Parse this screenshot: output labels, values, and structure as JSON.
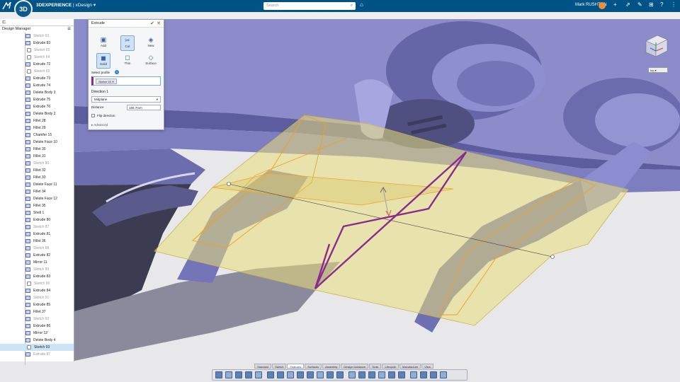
{
  "app": {
    "brand_title": "3DEXPERIENCE",
    "separator": "|",
    "app_name": "xDesign",
    "compass_label": "3D"
  },
  "search": {
    "placeholder": "Search"
  },
  "user": {
    "name": "Mark RUSHTON"
  },
  "tree": {
    "title": "Design Manager",
    "items": [
      {
        "label": "Sketch 63",
        "kind": "sketch",
        "dim": true
      },
      {
        "label": "Extrude 83",
        "kind": "feature"
      },
      {
        "label": "Sketch 65",
        "kind": "sketch",
        "dim": true,
        "sub": true
      },
      {
        "label": "Sketch 64",
        "kind": "sketch",
        "dim": true,
        "sub": true
      },
      {
        "label": "Extrude 72",
        "kind": "feature"
      },
      {
        "label": "Sketch 69",
        "kind": "sketch",
        "dim": true,
        "sub": true
      },
      {
        "label": "Extrude 73",
        "kind": "feature"
      },
      {
        "label": "Extrude 74",
        "kind": "feature"
      },
      {
        "label": "Delete Body 3",
        "kind": "feature"
      },
      {
        "label": "Extrude 75",
        "kind": "feature"
      },
      {
        "label": "Extrude 76",
        "kind": "feature"
      },
      {
        "label": "Delete Body 2",
        "kind": "feature"
      },
      {
        "label": "Fillet 28",
        "kind": "feature"
      },
      {
        "label": "Fillet 29",
        "kind": "feature"
      },
      {
        "label": "Chamfer 15",
        "kind": "feature"
      },
      {
        "label": "Delete Face 10",
        "kind": "feature"
      },
      {
        "label": "Fillet 30",
        "kind": "feature"
      },
      {
        "label": "Fillet 31",
        "kind": "feature"
      },
      {
        "label": "Sketch 80",
        "kind": "sketch",
        "dim": true
      },
      {
        "label": "Fillet 32",
        "kind": "feature"
      },
      {
        "label": "Fillet 33",
        "kind": "feature"
      },
      {
        "label": "Delete Face 11",
        "kind": "feature"
      },
      {
        "label": "Fillet 34",
        "kind": "feature"
      },
      {
        "label": "Delete Face 12",
        "kind": "feature"
      },
      {
        "label": "Fillet 35",
        "kind": "feature"
      },
      {
        "label": "Shell 1",
        "kind": "feature"
      },
      {
        "label": "Extrude 80",
        "kind": "feature"
      },
      {
        "label": "Sketch 87",
        "kind": "sketch",
        "dim": true
      },
      {
        "label": "Extrude 81",
        "kind": "feature"
      },
      {
        "label": "Fillet 36",
        "kind": "feature"
      },
      {
        "label": "Sketch 88",
        "kind": "sketch",
        "dim": true
      },
      {
        "label": "Extrude 82",
        "kind": "feature"
      },
      {
        "label": "Mirror 11",
        "kind": "feature"
      },
      {
        "label": "Sketch 89",
        "kind": "sketch",
        "dim": true
      },
      {
        "label": "Extrude 83",
        "kind": "feature"
      },
      {
        "label": "Sketch 90",
        "kind": "sketch",
        "dim": true,
        "sub": true
      },
      {
        "label": "Extrude 84",
        "kind": "feature"
      },
      {
        "label": "Sketch 91",
        "kind": "sketch",
        "dim": true
      },
      {
        "label": "Extrude 85",
        "kind": "feature"
      },
      {
        "label": "Fillet 37",
        "kind": "feature"
      },
      {
        "label": "Sketch 92",
        "kind": "sketch",
        "dim": true
      },
      {
        "label": "Extrude 86",
        "kind": "feature"
      },
      {
        "label": "Mirror 12",
        "kind": "feature"
      },
      {
        "label": "Delete Body 4",
        "kind": "feature"
      },
      {
        "label": "Sketch 93",
        "kind": "sketch",
        "sub": true,
        "selected": true
      },
      {
        "label": "Extrude 87",
        "kind": "feature",
        "dim": true
      }
    ]
  },
  "dialog": {
    "title": "Extrude",
    "operations": [
      {
        "label": "Add",
        "glyph": "▣",
        "icon": "add-icon"
      },
      {
        "label": "Cut",
        "glyph": "✂",
        "icon": "cut-icon",
        "active": true
      },
      {
        "label": "New",
        "glyph": "◈",
        "icon": "new-body-icon"
      },
      {
        "label": "Solid",
        "glyph": "◼",
        "icon": "solid-icon",
        "active": true
      },
      {
        "label": "Thin",
        "glyph": "◻",
        "icon": "thin-icon"
      },
      {
        "label": "Surface",
        "glyph": "◇",
        "icon": "surface-icon"
      }
    ],
    "profile_label": "Select profile",
    "profile_count": "1",
    "profile_chip": "Sketch 93",
    "direction_label": "Direction 1",
    "direction_value": "Midplane",
    "distance_label": "Distance",
    "distance_value": "165.7mm",
    "flip_label": "Flip direction",
    "advanced_label": "Advanced"
  },
  "zoom": {
    "value": "Iso"
  },
  "ribbon_tabs": [
    "Standard",
    "Sketch",
    "Features",
    "Surfaces",
    "Assembly",
    "Design Guidance",
    "Tools",
    "Lifecycle",
    "Manufacture",
    "View"
  ],
  "active_tab": "Features",
  "colors": {
    "topbar": "#005386",
    "model_blue": "#7e7fc3",
    "preview_fill": "#e8dc7a",
    "preview_edge": "#f0a020",
    "profile": "#8a2b8f"
  }
}
